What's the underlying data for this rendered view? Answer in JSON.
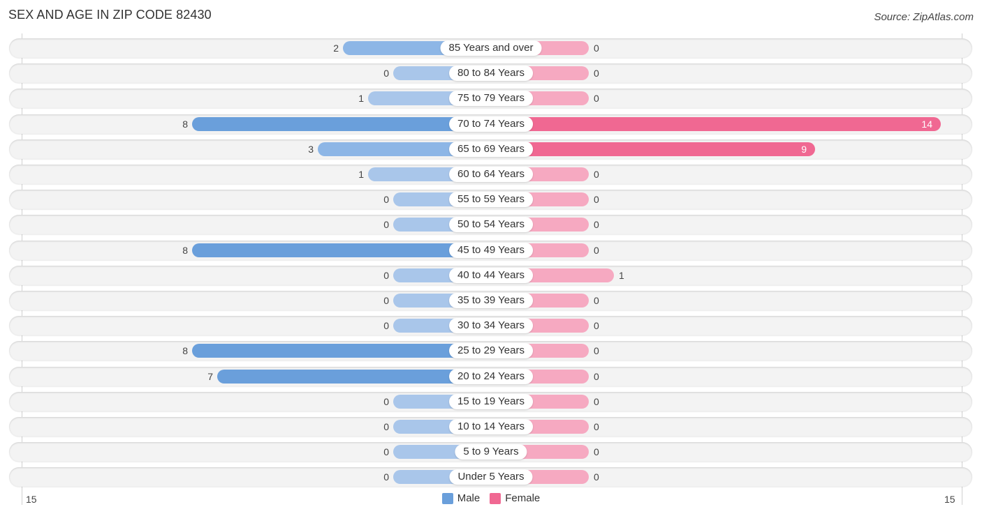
{
  "header": {
    "title": "SEX AND AGE IN ZIP CODE 82430",
    "source": "Source: ZipAtlas.com"
  },
  "colors": {
    "male": "#6a9fdb",
    "male_light": "#a9c6ea",
    "female": "#f06892",
    "female_light": "#f6a9c1"
  },
  "chart_data": {
    "type": "bar",
    "orientation": "horizontal-diverging",
    "title": "SEX AND AGE IN ZIP CODE 82430",
    "categories": [
      "85 Years and over",
      "80 to 84 Years",
      "75 to 79 Years",
      "70 to 74 Years",
      "65 to 69 Years",
      "60 to 64 Years",
      "55 to 59 Years",
      "50 to 54 Years",
      "45 to 49 Years",
      "40 to 44 Years",
      "35 to 39 Years",
      "30 to 34 Years",
      "25 to 29 Years",
      "20 to 24 Years",
      "15 to 19 Years",
      "10 to 14 Years",
      "5 to 9 Years",
      "Under 5 Years"
    ],
    "series": [
      {
        "name": "Male",
        "values": [
          2,
          0,
          1,
          8,
          3,
          1,
          0,
          0,
          8,
          0,
          0,
          0,
          8,
          7,
          0,
          0,
          0,
          0
        ]
      },
      {
        "name": "Female",
        "values": [
          0,
          0,
          0,
          14,
          9,
          0,
          0,
          0,
          0,
          1,
          0,
          0,
          0,
          0,
          0,
          0,
          0,
          0
        ]
      }
    ],
    "axis": {
      "left_tick": "15",
      "right_tick": "15",
      "xlim": [
        -15,
        15
      ]
    },
    "legend": {
      "position": "bottom-center",
      "entries": [
        "Male",
        "Female"
      ]
    },
    "grid": false
  }
}
